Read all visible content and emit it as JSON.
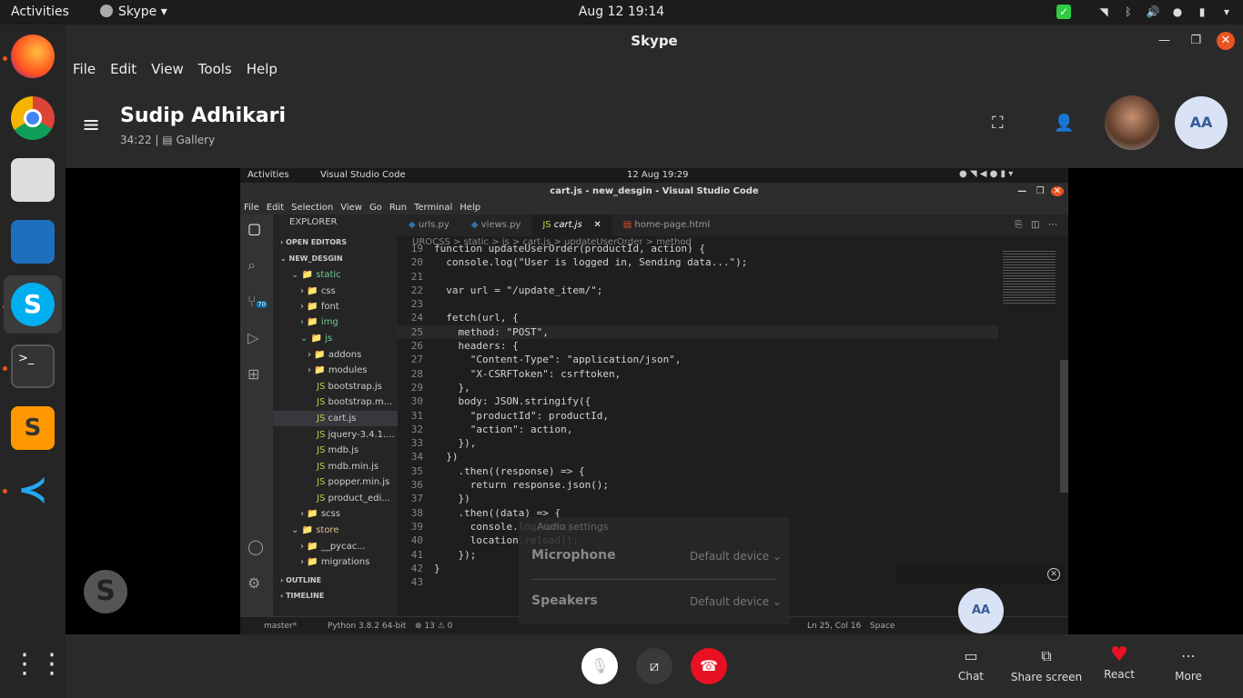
{
  "topbar": {
    "activities": "Activities",
    "app_name": "Skype",
    "clock": "Aug 12  19:14"
  },
  "window": {
    "title": "Skype",
    "menu": [
      "File",
      "Edit",
      "View",
      "Tools",
      "Help"
    ]
  },
  "call": {
    "contact_name": "Sudip Adhikari",
    "duration": "34:22",
    "view_mode": "Gallery",
    "self_initials": "AA"
  },
  "vscode": {
    "activities": "Activities",
    "app": "Visual Studio Code",
    "clock": "12 Aug  19:29",
    "title": "cart.js - new_desgin - Visual Studio Code",
    "menu": [
      "File",
      "Edit",
      "Selection",
      "View",
      "Go",
      "Run",
      "Terminal",
      "Help"
    ],
    "explorer_title": "EXPLORER",
    "open_editors": "OPEN EDITORS",
    "project": "NEW_DESGIN",
    "tree": [
      "static",
      "css",
      "font",
      "img",
      "js",
      "addons",
      "modules",
      "bootstrap.js",
      "bootstrap.m...",
      "cart.js",
      "jquery-3.4.1....",
      "mdb.js",
      "mdb.min.js",
      "popper.min.js",
      "product_edi...",
      "scss",
      "store",
      "__pycac...",
      "migrations"
    ],
    "outline": "OUTLINE",
    "timeline": "TIMELINE",
    "tabs": [
      "urls.py",
      "views.py",
      "cart.js",
      "home-page.html"
    ],
    "breadcrumb": "UROCSS  >  static  >  js  >  cart.js  >  updateUserOrder  >  method",
    "scm_badge": "70",
    "code_lines": [
      {
        "n": "19",
        "t": "function updateUserOrder(productId, action) {"
      },
      {
        "n": "20",
        "t": "  console.log(\"User is logged in, Sending data...\");"
      },
      {
        "n": "21",
        "t": ""
      },
      {
        "n": "22",
        "t": "  var url = \"/update_item/\";"
      },
      {
        "n": "23",
        "t": ""
      },
      {
        "n": "24",
        "t": "  fetch(url, {"
      },
      {
        "n": "25",
        "t": "    method: \"POST\","
      },
      {
        "n": "26",
        "t": "    headers: {"
      },
      {
        "n": "27",
        "t": "      \"Content-Type\": \"application/json\","
      },
      {
        "n": "28",
        "t": "      \"X-CSRFToken\": csrftoken,"
      },
      {
        "n": "29",
        "t": "    },"
      },
      {
        "n": "30",
        "t": "    body: JSON.stringify({"
      },
      {
        "n": "31",
        "t": "      \"productId\": productId,"
      },
      {
        "n": "32",
        "t": "      \"action\": action,"
      },
      {
        "n": "33",
        "t": "    }),"
      },
      {
        "n": "34",
        "t": "  })"
      },
      {
        "n": "35",
        "t": "    .then((response) => {"
      },
      {
        "n": "36",
        "t": "      return response.json();"
      },
      {
        "n": "37",
        "t": "    })"
      },
      {
        "n": "38",
        "t": "    .then((data) => {"
      },
      {
        "n": "39",
        "t": "      console.log(data);"
      },
      {
        "n": "40",
        "t": "      location.reload();"
      },
      {
        "n": "41",
        "t": "    });"
      },
      {
        "n": "42",
        "t": "}"
      },
      {
        "n": "43",
        "t": ""
      }
    ],
    "status_branch": "master*",
    "status_python": "Python 3.8.2 64-bit",
    "status_problems": "⊗ 13 ⚠ 0",
    "status_pos": "Ln 25, Col 16",
    "status_spaces": "Space"
  },
  "audio_settings": {
    "title": "Audio settings",
    "microphone_label": "Microphone",
    "microphone_value": "Default device",
    "speakers_label": "Speakers",
    "speakers_value": "Default device"
  },
  "controls": {
    "chat": "Chat",
    "share": "Share screen",
    "react": "React",
    "more": "More"
  },
  "colors": {
    "accent": "#e81123",
    "skype_blue": "#00aff0",
    "call_bg": "#2a2a2a"
  }
}
